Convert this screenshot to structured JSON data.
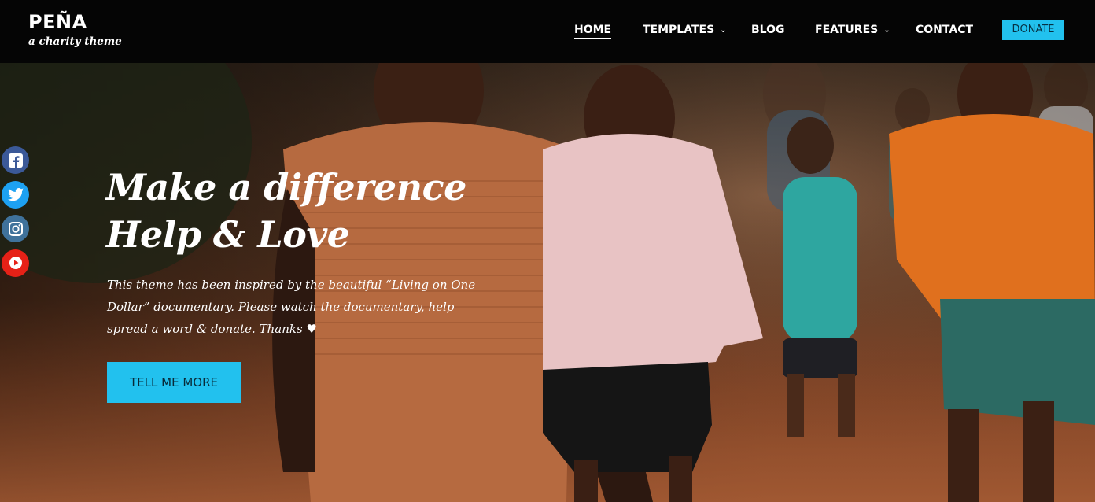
{
  "brand": {
    "name": "PEÑA",
    "tagline": "a charity theme"
  },
  "nav": {
    "items": [
      {
        "label": "HOME",
        "active": true
      },
      {
        "label": "TEMPLATES",
        "dropdown": true
      },
      {
        "label": "BLOG"
      },
      {
        "label": "FEATURES",
        "dropdown": true
      },
      {
        "label": "CONTACT"
      }
    ],
    "donate_label": "DONATE",
    "chevron": "⌄"
  },
  "hero": {
    "title_line1": "Make a difference",
    "title_line2": "Help & Love",
    "text": "This theme has been inspired by the beautiful “Living on One Dollar” documentary. Please watch the documentary, help spread a word & donate. Thanks ♥",
    "button_label": "TELL ME MORE"
  },
  "social": [
    {
      "icon": "facebook-icon",
      "color": "#3b5998"
    },
    {
      "icon": "twitter-icon",
      "color": "#1da1f2"
    },
    {
      "icon": "instagram-icon",
      "color": "#3f729b"
    },
    {
      "icon": "youtube-icon",
      "color": "#e62117"
    }
  ],
  "colors": {
    "accent": "#22c1ee",
    "header_bg": "#050505"
  }
}
